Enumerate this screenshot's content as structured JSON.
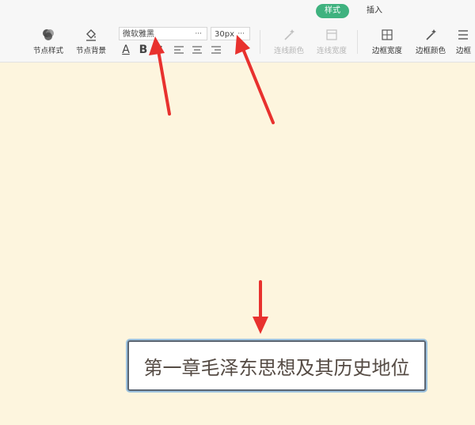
{
  "tabs": {
    "style_label": "样式",
    "insert_label": "插入"
  },
  "toolbar": {
    "node_style_label": "节点样式",
    "node_bg_label": "节点背景",
    "font_family_value": "微软雅黑",
    "font_size_value": "30px",
    "more_glyph": "···",
    "line_color_label": "连线颜色",
    "line_width_label": "连线宽度",
    "border_width_label": "边框宽度",
    "border_color_label": "边框颜色",
    "border_style_partial_label": "边框",
    "text_color_glyph": "A",
    "bold_glyph": "B"
  },
  "canvas": {
    "node_text": "第一章毛泽东思想及其历史地位"
  },
  "colors": {
    "active_tab": "#3fb27f",
    "canvas_bg": "#fdf5de",
    "arrow": "#e8312e",
    "node_border": "#5a6572",
    "node_text": "#554b44"
  }
}
